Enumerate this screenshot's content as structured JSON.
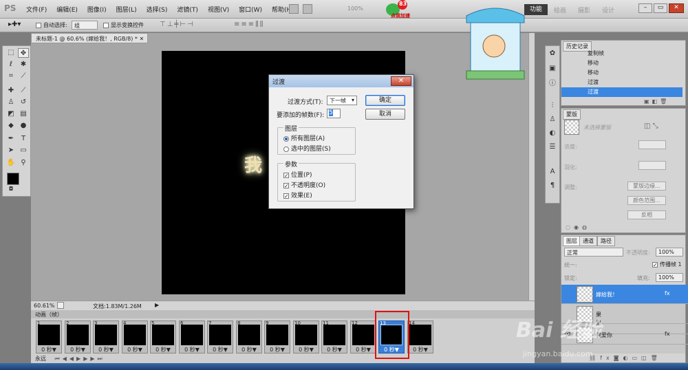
{
  "app": {
    "logo": "PS",
    "zoom": "100%"
  },
  "menus": [
    "文件(F)",
    "编辑(E)",
    "图像(I)",
    "图层(L)",
    "选择(S)",
    "滤镜(T)",
    "视图(V)",
    "窗口(W)",
    "帮助(H)"
  ],
  "workspace": {
    "items": [
      "功能",
      "绘画",
      "摄影",
      "设计"
    ],
    "active": "功能"
  },
  "badge": {
    "count": "83",
    "label": "点我加速"
  },
  "options": {
    "auto_select": "自动选择:",
    "group_value": "组",
    "show_transform": "显示变换控件"
  },
  "document": {
    "tab_title": "未标题-1 @ 60.6% (嫁给我！, RGB/8) *",
    "zoom": "60.61%",
    "doc_info": "文档:1.83M/1.26M",
    "canvas_text": "我"
  },
  "animation": {
    "title": "动画（帧）",
    "loop": "永远",
    "frames": [
      {
        "num": "1",
        "dur": "0 秒▼"
      },
      {
        "num": "2",
        "dur": "0 秒▼"
      },
      {
        "num": "3",
        "dur": "0 秒▼"
      },
      {
        "num": "4",
        "dur": "0 秒▼"
      },
      {
        "num": "5",
        "dur": "0 秒▼"
      },
      {
        "num": "6",
        "dur": "0 秒▼"
      },
      {
        "num": "7",
        "dur": "0 秒▼"
      },
      {
        "num": "8",
        "dur": "0 秒▼"
      },
      {
        "num": "9",
        "dur": "0 秒▼"
      },
      {
        "num": "10",
        "dur": "0 秒▼"
      },
      {
        "num": "11",
        "dur": "0 秒▼"
      },
      {
        "num": "12",
        "dur": "0 秒▼"
      },
      {
        "num": "13",
        "dur": "0 秒▼"
      },
      {
        "num": "14",
        "dur": "0 秒▼"
      }
    ]
  },
  "history": {
    "title": "历史记录",
    "items": [
      "复制帧",
      "移动",
      "移动",
      "过渡",
      "过渡"
    ]
  },
  "masks": {
    "title": "蒙版",
    "none_selected": "未选择蒙版",
    "density": "浓度:",
    "feather": "羽化:",
    "adjust": "调整:",
    "mask_edge": "蒙版边缘...",
    "color_range": "颜色范围...",
    "invert": "反相"
  },
  "layers": {
    "tabs": [
      "图层",
      "通道",
      "路径"
    ],
    "blend": "正常",
    "opacity_label": "不透明度:",
    "opacity": "100%",
    "unify": "统一:",
    "propagate": "传播帧 1",
    "lock": "锁定:",
    "fill_label": "填充:",
    "fill": "100%",
    "rows": [
      "嫁给我！",
      "果",
      "果",
      "我爱你"
    ]
  },
  "dialog": {
    "title": "过渡",
    "close": "✕",
    "method_label": "过渡方式(T):",
    "method_value": "下一帧",
    "frames_label": "要添加的帧数(F):",
    "frames_value": "5",
    "ok": "确定",
    "cancel": "取消",
    "layers_group": "图层",
    "all_layers": "所有图层(A)",
    "selected_layers": "选中的图层(S)",
    "params_group": "参数",
    "position": "位置(P)",
    "opacity": "不透明度(O)",
    "effects": "效果(E)"
  },
  "watermark": {
    "brand": "Bai 经验",
    "url": "jingyan.baidu.com"
  }
}
